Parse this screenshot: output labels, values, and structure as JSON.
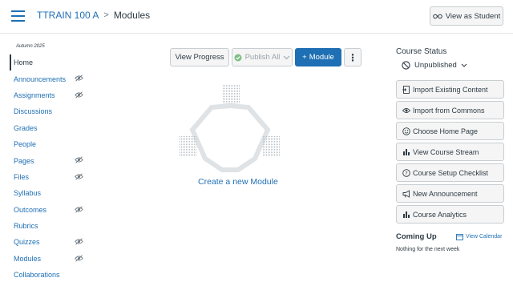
{
  "header": {
    "course": "TTRAIN 100 A",
    "separator": ">",
    "page": "Modules",
    "view_as_student": "View as Student"
  },
  "nav": {
    "term": "Autumn 2025",
    "items": [
      {
        "label": "Home",
        "hidden": false
      },
      {
        "label": "Announcements",
        "hidden": true
      },
      {
        "label": "Assignments",
        "hidden": true
      },
      {
        "label": "Discussions",
        "hidden": false
      },
      {
        "label": "Grades",
        "hidden": false
      },
      {
        "label": "People",
        "hidden": false
      },
      {
        "label": "Pages",
        "hidden": true
      },
      {
        "label": "Files",
        "hidden": true
      },
      {
        "label": "Syllabus",
        "hidden": false
      },
      {
        "label": "Outcomes",
        "hidden": true
      },
      {
        "label": "Rubrics",
        "hidden": false
      },
      {
        "label": "Quizzes",
        "hidden": true
      },
      {
        "label": "Modules",
        "hidden": true
      },
      {
        "label": "Collaborations",
        "hidden": false
      }
    ]
  },
  "toolbar": {
    "view_progress": "View Progress",
    "publish_all": "Publish All",
    "add_module": "Module",
    "add_prefix": "+",
    "more": "⋮"
  },
  "empty": {
    "create_link": "Create a new Module"
  },
  "sidebar": {
    "status_title": "Course Status",
    "status_value": "Unpublished",
    "buttons": [
      {
        "label": "Import Existing Content",
        "icon": "import-icon"
      },
      {
        "label": "Import from Commons",
        "icon": "commons-icon"
      },
      {
        "label": "Choose Home Page",
        "icon": "home-page-icon"
      },
      {
        "label": "View Course Stream",
        "icon": "stream-chart-icon"
      },
      {
        "label": "Course Setup Checklist",
        "icon": "checklist-icon"
      },
      {
        "label": "New Announcement",
        "icon": "megaphone-icon"
      },
      {
        "label": "Course Analytics",
        "icon": "analytics-chart-icon"
      }
    ],
    "coming_up_title": "Coming Up",
    "view_calendar": "View Calendar",
    "nothing": "Nothing for the next week"
  },
  "colors": {
    "link": "#1f6fb4",
    "text": "#2d3b45",
    "button_bg": "#f5f5f5",
    "border": "#c7cdd1",
    "primary": "#1f6fb4"
  }
}
